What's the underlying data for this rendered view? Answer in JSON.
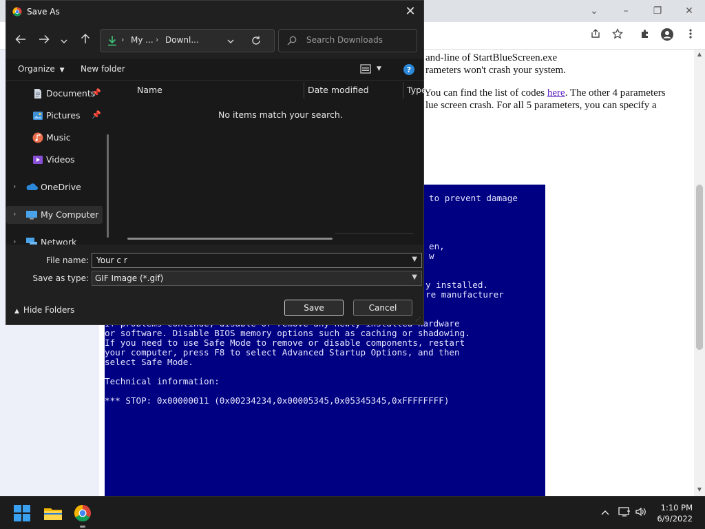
{
  "browser": {
    "window_controls": {
      "minimize": "–",
      "maximize": "❐",
      "close": "✕",
      "tab_list": "⌄"
    },
    "page": {
      "line1": "and-line of StartBlueScreen.exe",
      "line2": "rameters won't crash your system.",
      "line3_pre": "You can find the list of codes ",
      "line3_link": "here",
      "line3_post": ". The other 4 parameters",
      "line4": "lue screen crash. For all 5 parameters, you can specify a"
    },
    "bsod": {
      "l1": "to prevent damage",
      "l2": "en,",
      "l3": "w",
      "l4": "y installed.",
      "l5": "re manufacturer",
      "l6": "If problems continue, disable or remove any newly installed hardware",
      "l7": "or software. Disable BIOS memory options such as caching or shadowing.",
      "l8": "If you need to use Safe Mode to remove or disable components, restart",
      "l9": "your computer, press F8 to select Advanced Startup Options, and then",
      "l10": "select Safe Mode.",
      "l11": "Technical information:",
      "l12": "*** STOP: 0x00000011 (0x00234234,0x00005345,0x05345345,0xFFFFFFFF)"
    }
  },
  "dialog": {
    "title": "Save As",
    "close": "✕",
    "address": {
      "segment1": "My ...",
      "segment2": "Downl..."
    },
    "search_placeholder": "Search Downloads",
    "commands": {
      "organize": "Organize",
      "new_folder": "New folder"
    },
    "nav_items": [
      {
        "label": "Documents"
      },
      {
        "label": "Pictures"
      },
      {
        "label": "Music"
      },
      {
        "label": "Videos"
      },
      {
        "label": "OneDrive"
      },
      {
        "label": "My Computer"
      },
      {
        "label": "Network"
      }
    ],
    "columns": {
      "name": "Name",
      "date": "Date modified",
      "type": "Type"
    },
    "empty_message": "No items match your search.",
    "file_name_label": "File name:",
    "file_name_value": "Your c r",
    "save_as_type_label": "Save as type:",
    "save_as_type_value": "GIF Image (*.gif)",
    "hide_folders": "Hide Folders",
    "save": "Save",
    "cancel": "Cancel"
  },
  "taskbar": {
    "time": "1:10 PM",
    "date": "6/9/2022"
  },
  "colors": {
    "bsod_blue": "#000082",
    "dialog_bg": "#191919",
    "taskbar_bg": "#1c1c1c",
    "link": "#5a1dbd"
  }
}
